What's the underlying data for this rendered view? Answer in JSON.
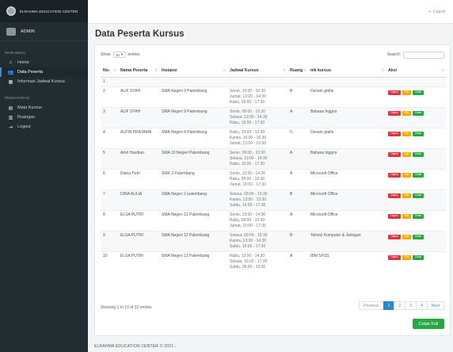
{
  "sidebar": {
    "brand": "ELRAHMA EDUCATION CENTER",
    "user": "ADMIN",
    "section_main": "MAIN MENU",
    "section_manage": "PENGATURAN",
    "items": [
      {
        "label": "Home",
        "icon": "home-icon"
      },
      {
        "label": "Data Peserta",
        "icon": "users-icon"
      },
      {
        "label": "Informasi Jadwal Kursus",
        "icon": "calendar-icon"
      },
      {
        "label": "Mata Kursus",
        "icon": "book-icon"
      },
      {
        "label": "Ruangan",
        "icon": "room-icon"
      },
      {
        "label": "Logout",
        "icon": "logout-icon"
      }
    ]
  },
  "topbar": {
    "logout": "Logout"
  },
  "page": {
    "title": "Data Peserta Kursus",
    "show_label": "Show",
    "entries_label": "entries",
    "entries_value": "10",
    "search_label": "Search:",
    "info": "Showing 1 to 10 of 32 entries",
    "cetak_full": "Cetak Full",
    "footer": "ELRAHMA EDUCATION CENTER © 2021 -"
  },
  "table": {
    "headers": [
      "No.",
      "Nama Peserta",
      "Instansi",
      "Jadwal Kursus",
      "Ruang",
      "mk kursus",
      "Aksi"
    ],
    "action_labels": {
      "delete": "Hapus",
      "edit": "Edit",
      "print": "Cetak"
    },
    "rows": [
      {
        "no": "1",
        "nama": "",
        "instansi": "",
        "jadwal": "",
        "ruang": "",
        "mk": "",
        "actions": false
      },
      {
        "no": "2",
        "nama": "ALIF SYAH",
        "instansi": "SMA Negeri 9 Palembang",
        "jadwal": "Senin, 10:00 - 10:30\nJumat, 13:00 - 14:30\nRabu, 16:00 - 17:30",
        "ruang": "B",
        "mk": "Desain grafis",
        "actions": true
      },
      {
        "no": "3",
        "nama": "ALIF SYAH",
        "instansi": "SMA Negeri 9 Palembang",
        "jadwal": "Senin, 09:00 - 10:30\nSelasa, 13:00 - 14:30\nRabu, 16:00 - 17:00",
        "ruang": "A",
        "mk": "Bahasa Inggris",
        "actions": true
      },
      {
        "no": "4",
        "nama": "ALPIN PRATAMA",
        "instansi": "SMA Negeri 8 Palembang",
        "jadwal": "Rabu, 10:00 - 10:30\nKamis, 16:00 - 16:30\nJumat, 13:00 - 13:30",
        "ruang": "C",
        "mk": "Desain grafis",
        "actions": true
      },
      {
        "no": "5",
        "nama": "Amri Hasibun",
        "instansi": "SMA 10 Negeri Palembang",
        "jadwal": "Senin, 09:00 - 10:30\nSelasa, 13:00 - 14:30\nRabu, 16:00 - 17:30",
        "ruang": "A",
        "mk": "Bahasa Inggris",
        "actions": true
      },
      {
        "no": "6",
        "nama": "Diana Putri",
        "instansi": "SMK 3 Palembang",
        "jadwal": "Senin, 13:00 - 14:30\nRabu, 09:00 - 10:30\nJumat, 16:00 - 17:30",
        "ruang": "A",
        "mk": "Microsoft Office",
        "actions": true
      },
      {
        "no": "7",
        "nama": "DINA AULIA",
        "instansi": "SMA Negeri 2 palembang",
        "jadwal": "Selasa, 09:00 - 10:30\nKamis, 13:00 - 13:30\nSabtu, 16:00 - 17:30",
        "ruang": "B",
        "mk": "Microsoft Office",
        "actions": true
      },
      {
        "no": "8",
        "nama": "ELSA PUTRI",
        "instansi": "SMA Negeri 12 Palembang",
        "jadwal": "Senin, 13:00 - 14:30\nRabu, 09:00 - 10:30\nJumat, 16:00 - 17:30",
        "ruang": "A",
        "mk": "Microsoft Office",
        "actions": true
      },
      {
        "no": "9",
        "nama": "ELSA PUTRI",
        "instansi": "SMA Negeri 12 Palembang",
        "jadwal": "Selasa, 09:00 - 10:30\nKamis, 13:00 - 14:30\nSabtu, 16:00 - 17:30",
        "ruang": "B",
        "mk": "Teknisi Komputer & Jaringan",
        "actions": true
      },
      {
        "no": "10",
        "nama": "ELSA PUTRI",
        "instansi": "SMA Negeri 12 Palembang",
        "jadwal": "Rabu, 13:00 - 14:30\nSelasa, 16:00 - 17:30\nSabtu, 09:00 - 10:30",
        "ruang": "A",
        "mk": "IBM SPSS",
        "actions": true
      }
    ]
  },
  "pagination": {
    "previous": "Previous",
    "pages": [
      "1",
      "2",
      "3",
      "4"
    ],
    "next": "Next",
    "current": "1"
  },
  "colors": {
    "sidebar_bg": "#222d32",
    "accent": "#3c8dbc",
    "danger": "#dc3545",
    "warning": "#f0ad00",
    "success": "#28a745"
  }
}
